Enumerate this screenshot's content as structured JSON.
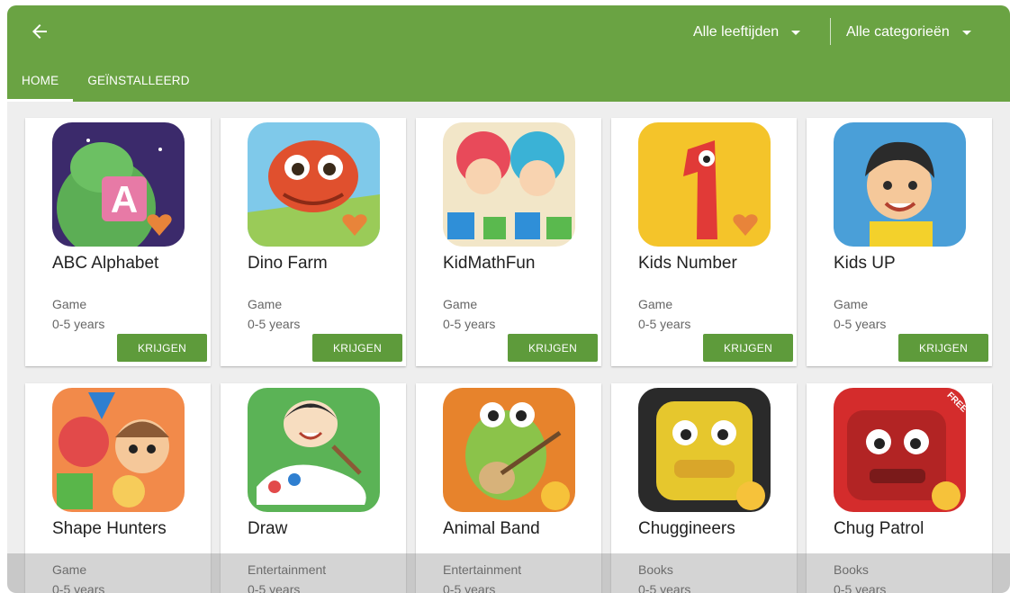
{
  "appbar": {
    "color": "#6aa343",
    "back_icon": "arrow-left-icon",
    "age_filter": "Alle leeftijden",
    "category_filter": "Alle categorieën",
    "caret_icon": "caret-down-icon"
  },
  "tabs": [
    {
      "label": "HOME",
      "active": true
    },
    {
      "label": "GEÏNSTALLEERD",
      "active": false
    }
  ],
  "button_color": "#5e9b3b",
  "apps": [
    {
      "name": "ABC Alphabet",
      "category": "Game",
      "age": "0-5 years",
      "button": "KRIJGEN",
      "icon": "abc-alphabet-icon"
    },
    {
      "name": "Dino Farm",
      "category": "Game",
      "age": "0-5 years",
      "button": "KRIJGEN",
      "icon": "dino-farm-icon"
    },
    {
      "name": "KidMathFun",
      "category": "Game",
      "age": "0-5 years",
      "button": "KRIJGEN",
      "icon": "kidmathfun-icon"
    },
    {
      "name": "Kids Number",
      "category": "Game",
      "age": "0-5 years",
      "button": "KRIJGEN",
      "icon": "kids-number-icon"
    },
    {
      "name": "Kids UP",
      "category": "Game",
      "age": "0-5 years",
      "button": "KRIJGEN",
      "icon": "kids-up-icon"
    },
    {
      "name": "Shape Hunters",
      "category": "Game",
      "age": "0-5 years",
      "icon": "shape-hunters-icon"
    },
    {
      "name": "Draw",
      "category": "Entertainment",
      "age": "0-5 years",
      "icon": "draw-icon"
    },
    {
      "name": "Animal Band",
      "category": "Entertainment",
      "age": "0-5 years",
      "icon": "animal-band-icon"
    },
    {
      "name": "Chuggineers",
      "category": "Books",
      "age": "0-5 years",
      "icon": "chuggineers-icon"
    },
    {
      "name": "Chug Patrol",
      "category": "Books",
      "age": "0-5 years",
      "badge": "FREE",
      "icon": "chug-patrol-icon"
    }
  ]
}
